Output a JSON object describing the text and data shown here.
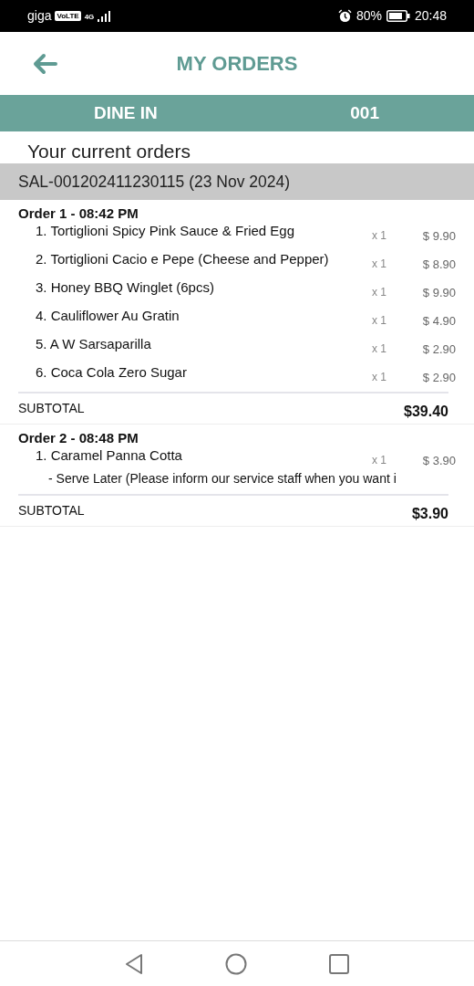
{
  "status_bar": {
    "carrier": "giga",
    "volte": "VoLTE",
    "network": "4G",
    "battery": "80%",
    "time": "20:48"
  },
  "header": {
    "title": "MY ORDERS"
  },
  "table_bar": {
    "mode": "DINE IN",
    "table": "001"
  },
  "section_title": "Your current orders",
  "bill": {
    "id": "SAL-001202411230115 (23 Nov 2024)"
  },
  "orders": [
    {
      "title": "Order 1 - 08:42 PM",
      "items": [
        {
          "name": "1. Tortiglioni Spicy Pink Sauce & Fried Egg",
          "qty": "x 1",
          "price": "$ 9.90"
        },
        {
          "name": "2. Tortiglioni Cacio e Pepe (Cheese and Pepper)",
          "qty": "x 1",
          "price": "$ 8.90"
        },
        {
          "name": "3. Honey BBQ Winglet (6pcs)",
          "qty": "x 1",
          "price": "$ 9.90"
        },
        {
          "name": "4. Cauliflower Au Gratin",
          "qty": "x 1",
          "price": "$ 4.90"
        },
        {
          "name": "5. A W Sarsaparilla",
          "qty": "x 1",
          "price": "$ 2.90"
        },
        {
          "name": "6. Coca Cola Zero Sugar",
          "qty": "x 1",
          "price": "$ 2.90"
        }
      ],
      "subtotal_label": "SUBTOTAL",
      "subtotal": "$39.40"
    },
    {
      "title": "Order 2 - 08:48 PM",
      "items": [
        {
          "name": "1. Caramel Panna Cotta",
          "qty": "x 1",
          "price": "$ 3.90",
          "note": "- Serve Later (Please inform our service staff when you want i"
        }
      ],
      "subtotal_label": "SUBTOTAL",
      "subtotal": "$3.90"
    }
  ]
}
